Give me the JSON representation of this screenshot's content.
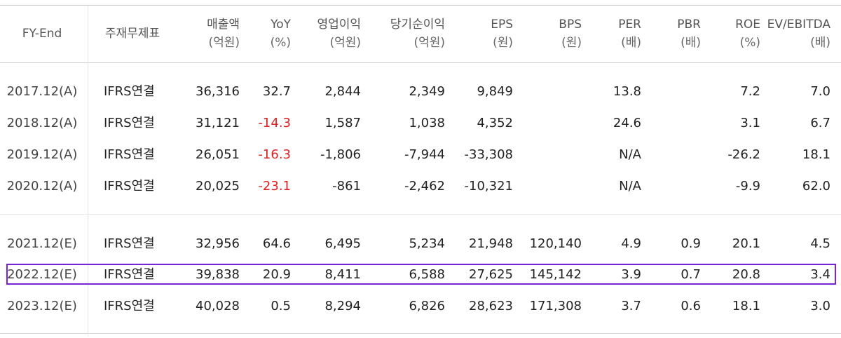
{
  "headers": [
    {
      "line1": "FY-End",
      "line2": ""
    },
    {
      "line1": "주재무제표",
      "line2": ""
    },
    {
      "line1": "매출액",
      "line2": "(억원)"
    },
    {
      "line1": "YoY",
      "line2": "(%)"
    },
    {
      "line1": "영업이익",
      "line2": "(억원)"
    },
    {
      "line1": "당기순이익",
      "line2": "(억원)"
    },
    {
      "line1": "EPS",
      "line2": "(원)"
    },
    {
      "line1": "BPS",
      "line2": "(원)"
    },
    {
      "line1": "PER",
      "line2": "(배)"
    },
    {
      "line1": "PBR",
      "line2": "(배)"
    },
    {
      "line1": "ROE",
      "line2": "(%)"
    },
    {
      "line1": "EV/EBITDA",
      "line2": "(배)"
    }
  ],
  "rows": [
    {
      "fy": "2017.12(A)",
      "statement": "IFRS연결",
      "revenue": "36,316",
      "yoy": "32.7",
      "op_income": "2,844",
      "net_income": "2,349",
      "eps": "9,849",
      "bps": "",
      "per": "13.8",
      "pbr": "",
      "roe": "7.2",
      "ev_ebitda": "7.0"
    },
    {
      "fy": "2018.12(A)",
      "statement": "IFRS연결",
      "revenue": "31,121",
      "yoy": "-14.3",
      "op_income": "1,587",
      "net_income": "1,038",
      "eps": "4,352",
      "bps": "",
      "per": "24.6",
      "pbr": "",
      "roe": "3.1",
      "ev_ebitda": "6.7"
    },
    {
      "fy": "2019.12(A)",
      "statement": "IFRS연결",
      "revenue": "26,051",
      "yoy": "-16.3",
      "op_income": "-1,806",
      "net_income": "-7,944",
      "eps": "-33,308",
      "bps": "",
      "per": "N/A",
      "pbr": "",
      "roe": "-26.2",
      "ev_ebitda": "18.1"
    },
    {
      "fy": "2020.12(A)",
      "statement": "IFRS연결",
      "revenue": "20,025",
      "yoy": "-23.1",
      "op_income": "-861",
      "net_income": "-2,462",
      "eps": "-10,321",
      "bps": "",
      "per": "N/A",
      "pbr": "",
      "roe": "-9.9",
      "ev_ebitda": "62.0"
    },
    {
      "fy": "2021.12(E)",
      "statement": "IFRS연결",
      "revenue": "32,956",
      "yoy": "64.6",
      "op_income": "6,495",
      "net_income": "5,234",
      "eps": "21,948",
      "bps": "120,140",
      "per": "4.9",
      "pbr": "0.9",
      "roe": "20.1",
      "ev_ebitda": "4.5"
    },
    {
      "fy": "2022.12(E)",
      "statement": "IFRS연결",
      "revenue": "39,838",
      "yoy": "20.9",
      "op_income": "8,411",
      "net_income": "6,588",
      "eps": "27,625",
      "bps": "145,142",
      "per": "3.9",
      "pbr": "0.7",
      "roe": "20.8",
      "ev_ebitda": "3.4"
    },
    {
      "fy": "2023.12(E)",
      "statement": "IFRS연결",
      "revenue": "40,028",
      "yoy": "0.5",
      "op_income": "8,294",
      "net_income": "6,826",
      "eps": "28,623",
      "bps": "171,308",
      "per": "3.7",
      "pbr": "0.6",
      "roe": "18.1",
      "ev_ebitda": "3.0"
    }
  ],
  "highlight_row": "2022.12(E)",
  "colors": {
    "negative_yoy": "#e02020",
    "highlight_border": "#7a22d6",
    "rule_dark": "#999999",
    "rule_light": "#e3e3e3"
  }
}
